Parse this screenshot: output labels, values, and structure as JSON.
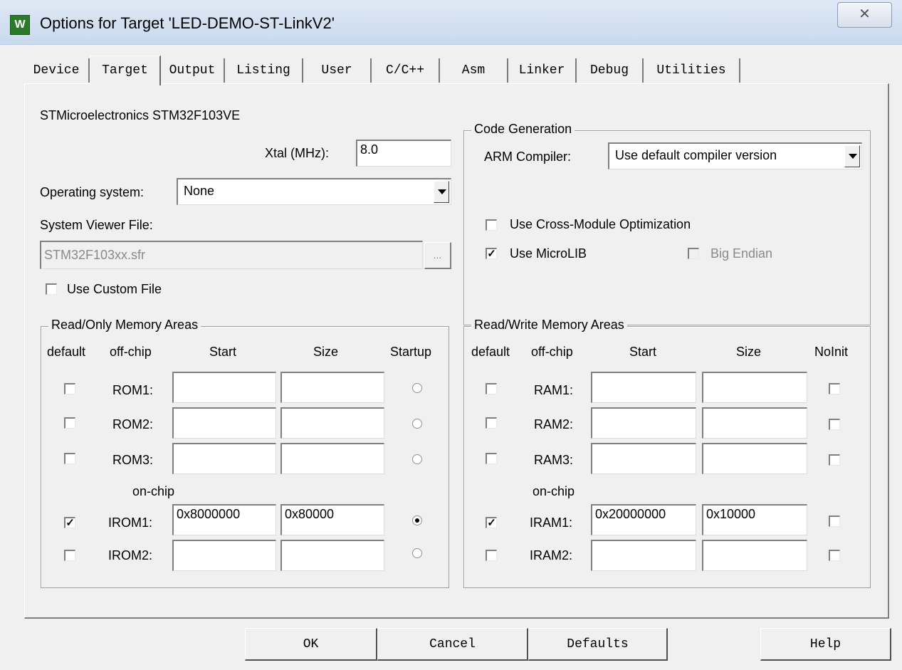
{
  "window": {
    "title": "Options for Target 'LED-DEMO-ST-LinkV2'",
    "icon": "keil-uvision-icon",
    "close_glyph": "✕"
  },
  "tabs": [
    "Device",
    "Target",
    "Output",
    "Listing",
    "User",
    "C/C++",
    "Asm",
    "Linker",
    "Debug",
    "Utilities"
  ],
  "active_tab": "Target",
  "target": {
    "device_name": "STMicroelectronics STM32F103VE",
    "xtal_label": "Xtal (MHz):",
    "xtal_value": "8.0",
    "os_label": "Operating system:",
    "os_value": "None",
    "svf_label": "System Viewer File:",
    "svf_value": "STM32F103xx.sfr",
    "browse_label": "...",
    "use_custom_file_label": "Use Custom File",
    "use_custom_file_checked": false
  },
  "code_generation": {
    "legend": "Code Generation",
    "compiler_label": "ARM Compiler:",
    "compiler_value": "Use default compiler version",
    "cross_module_label": "Use Cross-Module Optimization",
    "cross_module_checked": false,
    "microlib_label": "Use MicroLIB",
    "microlib_checked": true,
    "big_endian_label": "Big Endian",
    "big_endian_checked": false
  },
  "rom": {
    "legend": "Read/Only Memory Areas",
    "headers": {
      "default": "default",
      "offchip": "off-chip",
      "start": "Start",
      "size": "Size",
      "startup": "Startup"
    },
    "onchip_label": "on-chip",
    "rows": [
      {
        "name": "ROM1:",
        "default": false,
        "start": "",
        "size": "",
        "startup": false
      },
      {
        "name": "ROM2:",
        "default": false,
        "start": "",
        "size": "",
        "startup": false
      },
      {
        "name": "ROM3:",
        "default": false,
        "start": "",
        "size": "",
        "startup": false
      },
      {
        "name": "IROM1:",
        "default": true,
        "start": "0x8000000",
        "size": "0x80000",
        "startup": true
      },
      {
        "name": "IROM2:",
        "default": false,
        "start": "",
        "size": "",
        "startup": false
      }
    ]
  },
  "ram": {
    "legend": "Read/Write Memory Areas",
    "headers": {
      "default": "default",
      "offchip": "off-chip",
      "start": "Start",
      "size": "Size",
      "noinit": "NoInit"
    },
    "onchip_label": "on-chip",
    "rows": [
      {
        "name": "RAM1:",
        "default": false,
        "start": "",
        "size": "",
        "noinit": false
      },
      {
        "name": "RAM2:",
        "default": false,
        "start": "",
        "size": "",
        "noinit": false
      },
      {
        "name": "RAM3:",
        "default": false,
        "start": "",
        "size": "",
        "noinit": false
      },
      {
        "name": "IRAM1:",
        "default": true,
        "start": "0x20000000",
        "size": "0x10000",
        "noinit": false
      },
      {
        "name": "IRAM2:",
        "default": false,
        "start": "",
        "size": "",
        "noinit": false
      }
    ]
  },
  "buttons": {
    "ok": "OK",
    "cancel": "Cancel",
    "defaults": "Defaults",
    "help": "Help"
  },
  "check_glyph": "✓"
}
